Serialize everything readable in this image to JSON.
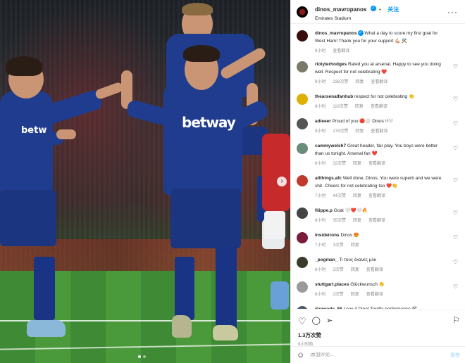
{
  "photo": {
    "sponsor_main": "betway",
    "sponsor_left": "betw",
    "next_glyph": "›"
  },
  "header": {
    "username": "dinos_mavropanos",
    "verified_glyph": "✓",
    "dot": "•",
    "follow_label": "关注",
    "location": "Emirates Stadium",
    "more_glyph": "···"
  },
  "comments": [
    {
      "user": "dinos_mavropanos",
      "text": "What a day to score my first goal for West Ham! Thank you for your support 💪🏼 ⚒️",
      "time": "8小时",
      "likes": "",
      "reply": "",
      "translate": "查看翻译",
      "avatar_color": "#3a0d0d",
      "is_caption": true
    },
    {
      "user": "riotylerhodges",
      "text": "Rated you at arsenal. Happy to see you doing well. Respect for not celebrating ❤️",
      "time": "8小时",
      "likes": "238次赞",
      "reply": "回复",
      "translate": "查看翻译",
      "avatar_color": "#7a7a6a"
    },
    {
      "user": "thearsenalfanhub",
      "text": "respect for not celebrating 👏",
      "time": "8小时",
      "likes": "119次赞",
      "reply": "回复",
      "translate": "查看翻译",
      "avatar_color": "#e0b000"
    },
    {
      "user": "adieeer",
      "text": "Proud of you 🔴⚪ Dinos !!🤍",
      "time": "8小时",
      "likes": "178次赞",
      "reply": "回复",
      "translate": "查看翻译",
      "avatar_color": "#555555"
    },
    {
      "user": "cammywelsh7",
      "text": "Great header, fair play. You boys were better than us tonight. Arsenal fan ❤️",
      "time": "8小时",
      "likes": "32次赞",
      "reply": "回复",
      "translate": "查看翻译",
      "avatar_color": "#6b8b7a"
    },
    {
      "user": "allthings.afc",
      "text": "Well done, Dinos. You were superb and we were shit. Cheers for not celebrating too ❤️👏",
      "time": "7小时",
      "likes": "44次赞",
      "reply": "回复",
      "translate": "查看翻译",
      "avatar_color": "#c0392b"
    },
    {
      "user": "filippe.p",
      "text": "Goat 🤍❤️🤍🔥",
      "time": "8小时",
      "likes": "35次赞",
      "reply": "回复",
      "translate": "查看翻译",
      "avatar_color": "#444444"
    },
    {
      "user": "insideirons",
      "text": "Dinos 😍",
      "time": "7小时",
      "likes": "3次赞",
      "reply": "回复",
      "translate": "",
      "avatar_color": "#7a1c3a"
    },
    {
      "user": "_pogman_",
      "text": "Τι τους έκανες μλκ",
      "time": "8小时",
      "likes": "3次赞",
      "reply": "回复",
      "translate": "查看翻译",
      "avatar_color": "#3b3b2b"
    },
    {
      "user": "stuttgart.places",
      "text": "Glückwunsch 👏",
      "time": "8小时",
      "likes": "2次赞",
      "reply": "回复",
      "translate": "查看翻译",
      "avatar_color": "#9a9a9a"
    },
    {
      "user": "danwade_86",
      "text": "Love it Dino! Terrific performance ⚒️",
      "time": "8小时",
      "likes": "11次赞",
      "reply": "回复",
      "translate": "查看翻译",
      "avatar_color": "#4a5a6a"
    }
  ],
  "actions": {
    "like_glyph": "♡",
    "comment_glyph": "◯",
    "share_glyph": "➢",
    "save_glyph": "⚐",
    "likes_count": "1.3万次赞",
    "posted": "8小时前"
  },
  "add_comment": {
    "emoji_glyph": "☺",
    "placeholder": "添加评论...",
    "post_label": "发布"
  },
  "heart_glyph": "♡"
}
